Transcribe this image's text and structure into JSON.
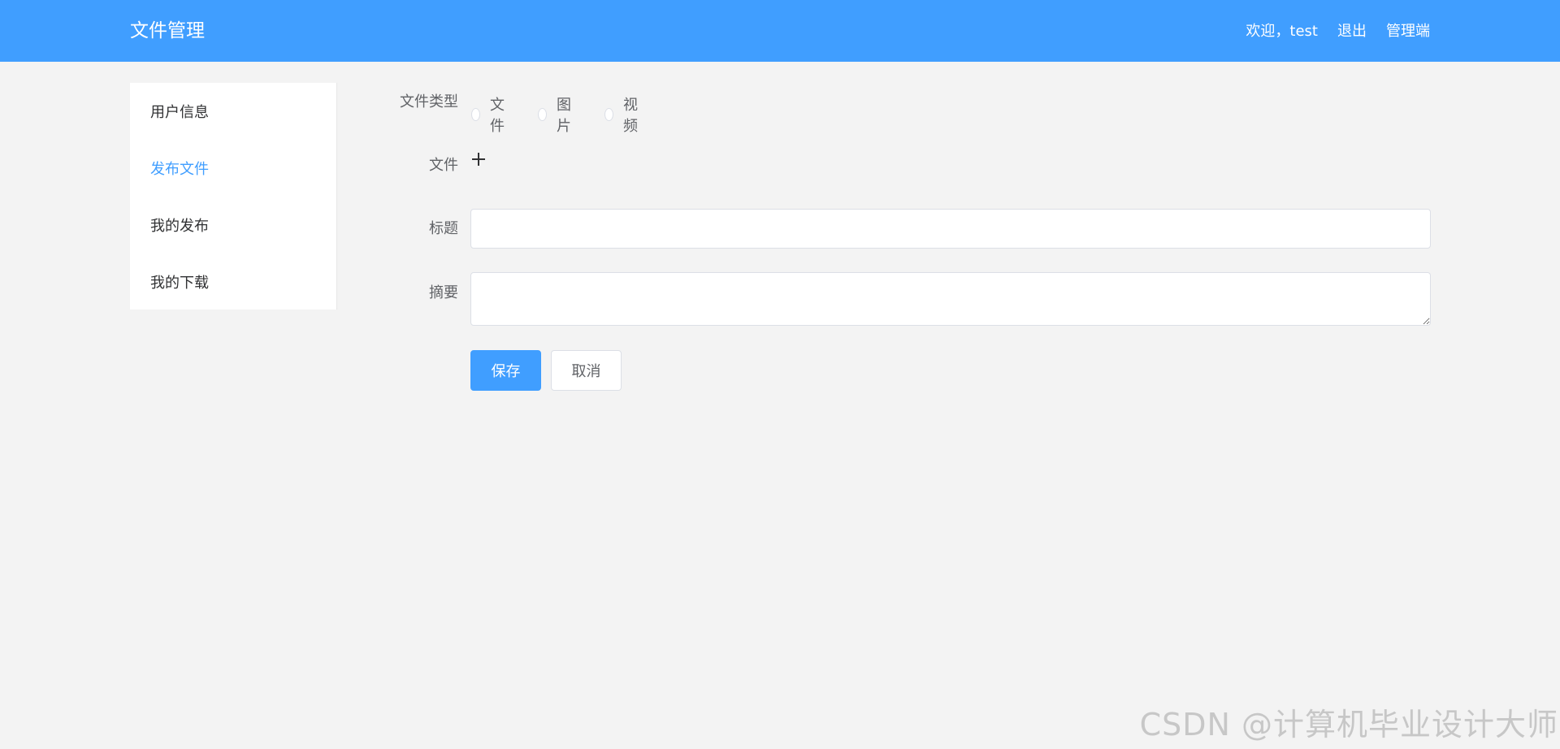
{
  "header": {
    "brand": "文件管理",
    "welcome": "欢迎，test",
    "logout": "退出",
    "admin": "管理端",
    "bg_color": "#409eff"
  },
  "sidebar": {
    "items": [
      {
        "label": "用户信息",
        "active": false
      },
      {
        "label": "发布文件",
        "active": true
      },
      {
        "label": "我的发布",
        "active": false
      },
      {
        "label": "我的下载",
        "active": false
      }
    ],
    "active_color": "#409eff"
  },
  "form": {
    "type_label": "文件类型",
    "type_options": [
      "文件",
      "图片",
      "视频"
    ],
    "type_selected": null,
    "file_label": "文件",
    "upload_icon": "plus-icon",
    "title_label": "标题",
    "title_value": "",
    "summary_label": "摘要",
    "summary_value": "",
    "save_label": "保存",
    "cancel_label": "取消"
  },
  "watermark": "CSDN @计算机毕业设计大师"
}
